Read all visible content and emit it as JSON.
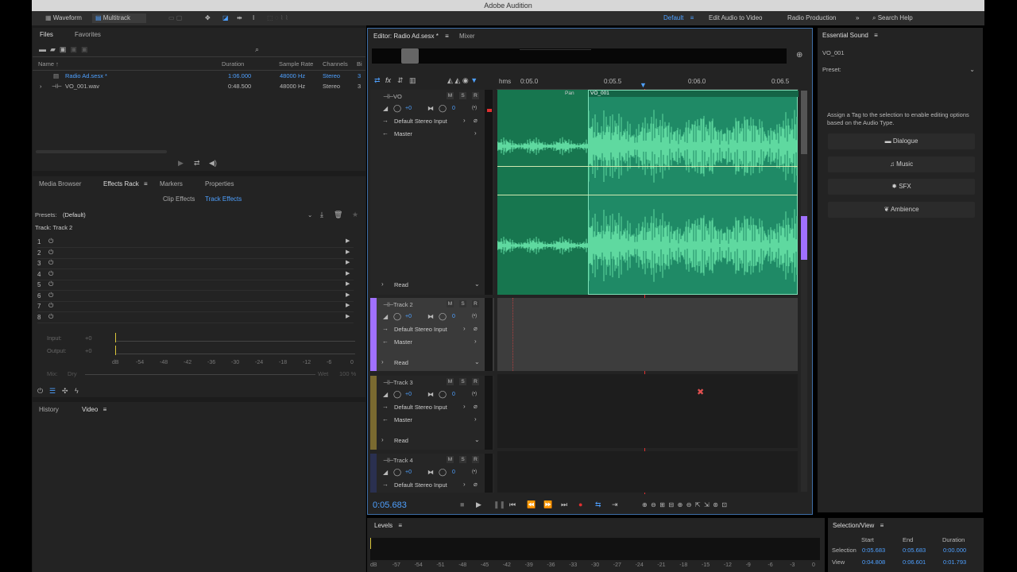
{
  "app": {
    "title": "Adobe Audition"
  },
  "toolbar": {
    "waveform": "Waveform",
    "multitrack": "Multitrack",
    "workspaces": [
      "Default",
      "Edit Audio to Video",
      "Radio Production"
    ],
    "search_placeholder": "Search Help"
  },
  "files": {
    "tab_files": "Files",
    "tab_favorites": "Favorites",
    "columns": [
      "Name ↑",
      "Duration",
      "Sample Rate",
      "Channels",
      "Bi"
    ],
    "rows": [
      {
        "name": "Radio Ad.sesx *",
        "duration": "1:06.000",
        "rate": "48000 Hz",
        "channels": "Stereo",
        "bits": "3"
      },
      {
        "name": "VO_001.wav",
        "duration": "0:48.500",
        "rate": "48000 Hz",
        "channels": "Stereo",
        "bits": "3"
      }
    ]
  },
  "effects": {
    "tabs": [
      "Media Browser",
      "Effects Rack",
      "Markers",
      "Properties"
    ],
    "subtabs": [
      "Clip Effects",
      "Track Effects"
    ],
    "presets_label": "Presets:",
    "presets_value": "(Default)",
    "track_label": "Track: Track 2",
    "slots": [
      "1",
      "2",
      "3",
      "4",
      "5",
      "6",
      "7",
      "8"
    ],
    "input_label": "Input:",
    "output_label": "Output:",
    "input_val": "+0",
    "output_val": "+0",
    "scale": [
      "dB",
      "-54",
      "-48",
      "-42",
      "-36",
      "-30",
      "-24",
      "-18",
      "-12",
      "-6",
      "0"
    ],
    "mix_label": "Mix:",
    "mix_dry": "Dry",
    "mix_wet": "Wet",
    "mix_pct": "100 %"
  },
  "history": {
    "tab_history": "History",
    "tab_video": "Video"
  },
  "editor": {
    "tab_editor": "Editor: Radio Ad.sesx *",
    "tab_mixer": "Mixer",
    "ruler_unit": "hms",
    "ruler_ticks": [
      "0:05.0",
      "0:05.5",
      "0:06.0",
      "0:06.5"
    ],
    "clip_label": "VO_001",
    "pan_label": "Pan",
    "time": "0:05.683"
  },
  "tracks": [
    {
      "name": "VO",
      "vol": "+0",
      "pan": "0",
      "input": "Default Stereo Input",
      "output": "Master",
      "mode": "Read"
    },
    {
      "name": "Track 2",
      "vol": "+0",
      "pan": "0",
      "input": "Default Stereo Input",
      "output": "Master",
      "mode": "Read"
    },
    {
      "name": "Track 3",
      "vol": "+0",
      "pan": "0",
      "input": "Default Stereo Input",
      "output": "Master",
      "mode": "Read"
    },
    {
      "name": "Track 4",
      "vol": "+0",
      "pan": "0",
      "input": "Default Stereo Input",
      "output": "",
      "mode": ""
    }
  ],
  "track_btns": {
    "m": "M",
    "s": "S",
    "r": "R"
  },
  "essential": {
    "title": "Essential Sound",
    "clip": "VO_001",
    "preset_label": "Preset:",
    "hint": "Assign a Tag to the selection to enable editing options based on the Audio Type.",
    "buttons": [
      "Dialogue",
      "Music",
      "SFX",
      "Ambience"
    ]
  },
  "levels": {
    "title": "Levels",
    "scale": [
      "dB",
      "-57",
      "-54",
      "-51",
      "-48",
      "-45",
      "-42",
      "-39",
      "-36",
      "-33",
      "-30",
      "-27",
      "-24",
      "-21",
      "-18",
      "-15",
      "-12",
      "-9",
      "-6",
      "-3",
      "0"
    ]
  },
  "selection_view": {
    "title": "Selection/View",
    "headers": [
      "Start",
      "End",
      "Duration"
    ],
    "rows": [
      {
        "label": "Selection",
        "start": "0:05.683",
        "end": "0:05.683",
        "duration": "0:00.000"
      },
      {
        "label": "View",
        "start": "0:04.808",
        "end": "0:06.601",
        "duration": "0:01.793"
      }
    ]
  },
  "colors": {
    "accent": "#4ea0ff",
    "wave": "#5fd9a0",
    "clip_bg": "#1f8a66",
    "track2": "#a070ff",
    "track3": "#7a6a30",
    "playhead": "#e03030"
  }
}
